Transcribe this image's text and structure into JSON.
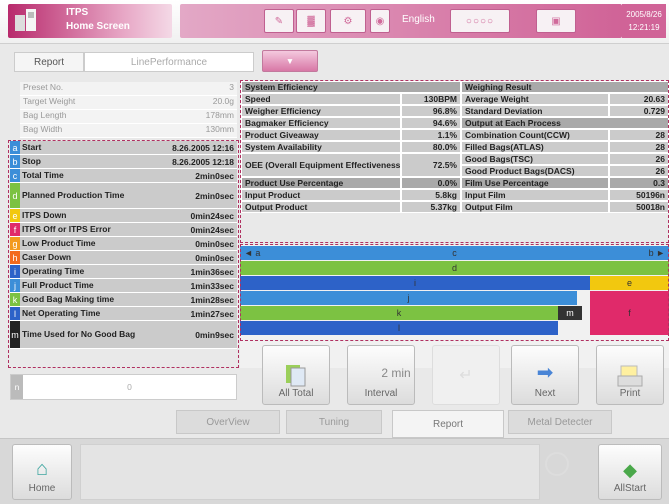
{
  "header": {
    "title_line1": "ITPS",
    "title_line2": "Home Screen",
    "language": "English",
    "date": "2005/8/26",
    "time": "12:21:19",
    "accent": "#d06397"
  },
  "tabs": {
    "report": "Report",
    "line_performance": "LinePerformance"
  },
  "presets": [
    {
      "label": "Preset No.",
      "value": "3"
    },
    {
      "label": "Target Weight",
      "value": "20.0g"
    },
    {
      "label": "Bag Length",
      "value": "178mm"
    },
    {
      "label": "Bag Width",
      "value": "130mm"
    }
  ],
  "left_rows": [
    {
      "letter": "a",
      "color": "#3c8ed8",
      "label": "Start",
      "value": "8.26.2005 12:16"
    },
    {
      "letter": "b",
      "color": "#3c8ed8",
      "label": "Stop",
      "value": "8.26.2005 12:18"
    },
    {
      "letter": "c",
      "color": "#3c8ed8",
      "label": "Total Time",
      "value": "2min0sec"
    },
    {
      "letter": "d",
      "color": "#7cc242",
      "label": "Planned Production Time",
      "value": "2min0sec"
    },
    {
      "letter": "e",
      "color": "#f2c80f",
      "label": "ITPS Down",
      "value": "0min24sec"
    },
    {
      "letter": "f",
      "color": "#e02a6a",
      "label": "ITPS Off or ITPS Error",
      "value": "0min24sec"
    },
    {
      "letter": "g",
      "color": "#f39a1e",
      "label": "Low Product Time",
      "value": "0min0sec"
    },
    {
      "letter": "h",
      "color": "#f36a1e",
      "label": "Caser Down",
      "value": "0min0sec"
    },
    {
      "letter": "i",
      "color": "#2d62c8",
      "label": "Operating Time",
      "value": "1min36sec"
    },
    {
      "letter": "j",
      "color": "#3c8ed8",
      "label": "Full Product Time",
      "value": "1min33sec"
    },
    {
      "letter": "k",
      "color": "#7cc242",
      "label": "Good Bag Making time",
      "value": "1min28sec"
    },
    {
      "letter": "l",
      "color": "#2d62c8",
      "label": "Net Operating Time",
      "value": "1min27sec"
    },
    {
      "letter": "m",
      "color": "#222222",
      "label": "Time Used for No Good Bag",
      "value": "0min9sec"
    }
  ],
  "n_row": {
    "letter": "n",
    "value": "0"
  },
  "system_efficiency": {
    "header": "System Efficiency",
    "rows": [
      {
        "label": "Speed",
        "value": "130BPM"
      },
      {
        "label": "Weigher Efficiency",
        "value": "96.8%"
      },
      {
        "label": "Bagmaker Efficiency",
        "value": "94.6%"
      },
      {
        "label": "Product Giveaway",
        "value": "1.1%"
      },
      {
        "label": "System Availability",
        "value": "80.0%"
      },
      {
        "label": "OEE (Overall Equipment Effectiveness)",
        "value": "72.5%"
      }
    ]
  },
  "weighing_result": {
    "header": "Weighing Result",
    "rows": [
      {
        "label": "Average Weight",
        "value": "20.63"
      },
      {
        "label": "Standard Deviation",
        "value": "0.729"
      }
    ]
  },
  "output_process": {
    "header": "Output at Each Process",
    "rows": [
      {
        "label": "Combination Count(CCW)",
        "value": "28"
      },
      {
        "label": "Filled Bags(ATLAS)",
        "value": "28"
      },
      {
        "label": "Good Bags(TSC)",
        "value": "26"
      },
      {
        "label": "Good Product Bags(DACS)",
        "value": "26"
      }
    ]
  },
  "product_use": {
    "header": "Product Use Percentage",
    "header_value": "0.0%",
    "rows": [
      {
        "label": "Input Product",
        "value": "5.8kg"
      },
      {
        "label": "Output Product",
        "value": "5.37kg"
      }
    ]
  },
  "film_use": {
    "header": "Film Use Percentage",
    "header_value": "0.3",
    "rows": [
      {
        "label": "Input Film",
        "value": "50196n"
      },
      {
        "label": "Output Film",
        "value": "50018n"
      }
    ]
  },
  "bars": {
    "row1": {
      "left": "◄ a",
      "center": "c",
      "right": "b ►"
    },
    "d": "d",
    "e": "e",
    "f": "f",
    "i": "i",
    "j": "j",
    "k": "k",
    "l": "l",
    "m": "m"
  },
  "buttons": {
    "all_total": "All Total",
    "interval_value": "2 min",
    "interval": "Interval",
    "next": "Next",
    "print": "Print"
  },
  "screen_tabs": [
    "OverView",
    "Tuning",
    "Report",
    "Metal Detecter"
  ],
  "bottom": {
    "home": "Home",
    "allstart": "AllStart"
  }
}
